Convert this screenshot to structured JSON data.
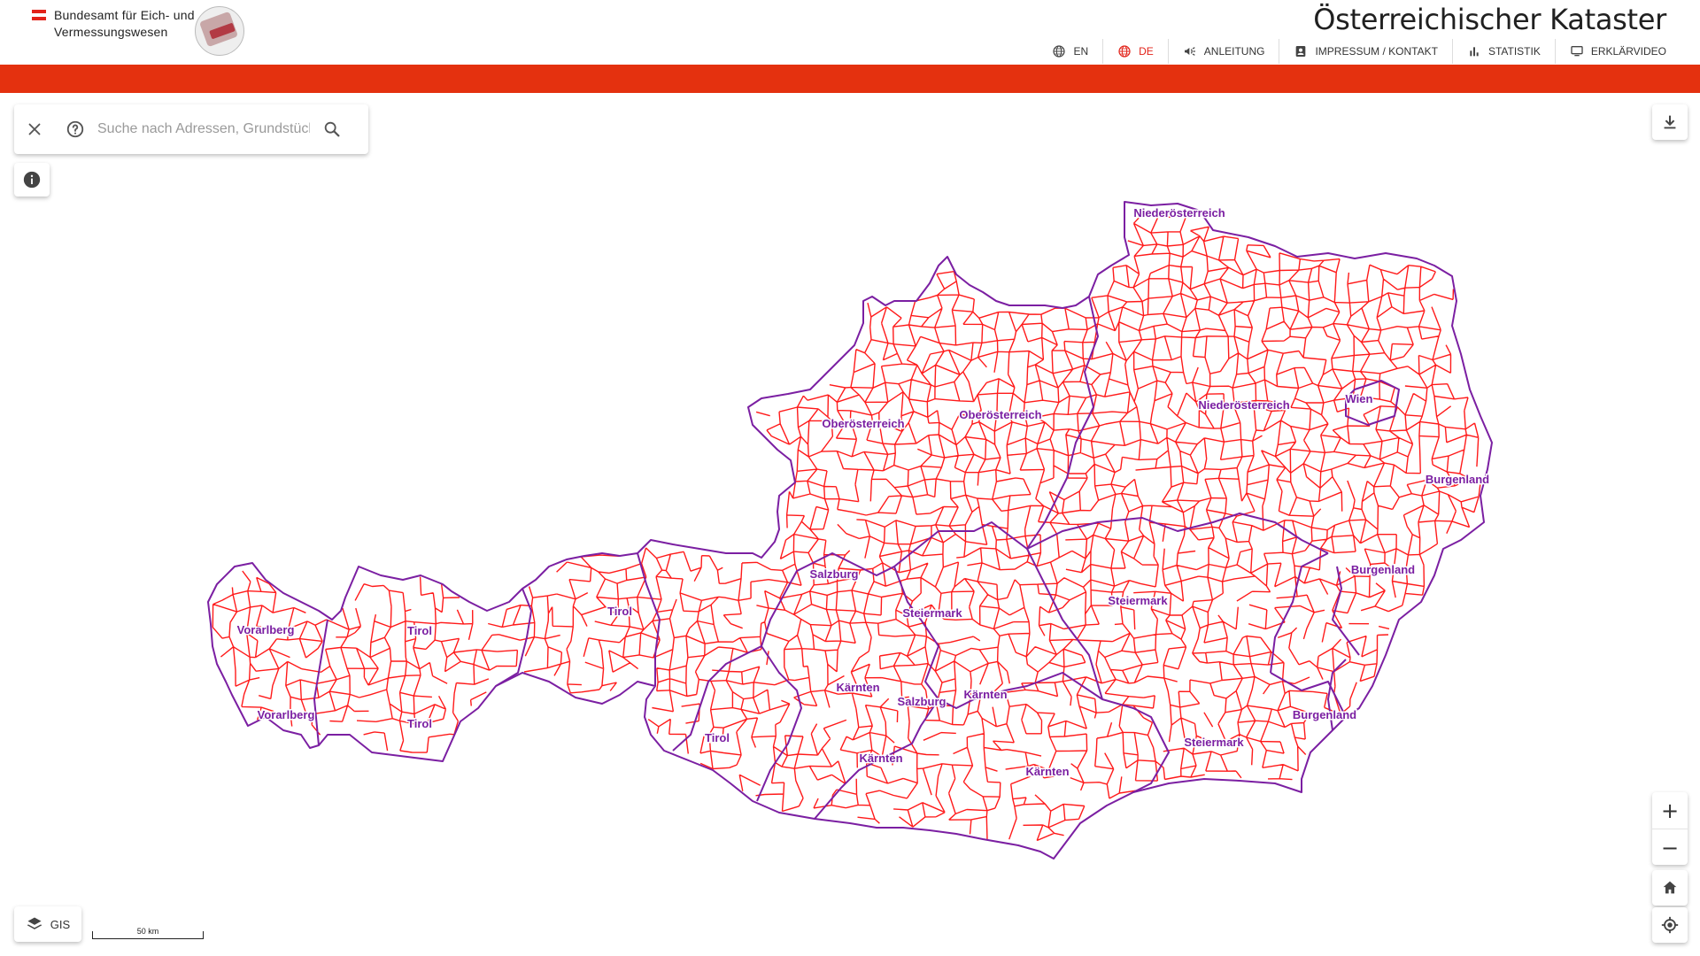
{
  "header": {
    "org_name": "Bundesamt für Eich- und Vermessungswesen",
    "app_title": "Österreichischer Kataster",
    "nav": [
      {
        "icon": "globe-icon",
        "label": "EN",
        "active": false
      },
      {
        "icon": "globe-icon",
        "label": "DE",
        "active": true
      },
      {
        "icon": "megaphone-icon",
        "label": "ANLEITUNG",
        "active": false
      },
      {
        "icon": "contact-card-icon",
        "label": "IMPRESSUM / KONTAKT",
        "active": false
      },
      {
        "icon": "bar-chart-icon",
        "label": "STATISTIK",
        "active": false
      },
      {
        "icon": "monitor-icon",
        "label": "ERKLÄRVIDEO",
        "active": false
      }
    ]
  },
  "colors": {
    "accent": "#e4310f",
    "parcel_border": "#ff1a1a",
    "state_border": "#7b1fa2",
    "state_label": "#7b1fa2"
  },
  "search": {
    "placeholder": "Suche nach Adressen, Grundstücken"
  },
  "controls": {
    "zoom_in": "+",
    "zoom_out": "−",
    "layer_label": "GIS"
  },
  "scale": {
    "label": "50 km"
  },
  "map": {
    "region_labels": [
      "Niederösterreich",
      "Oberösterreich",
      "Oberösterreich",
      "Niederösterreich",
      "Wien",
      "Burgenland",
      "Salzburg",
      "Burgenland",
      "Steiermark",
      "Steiermark",
      "Vorarlberg",
      "Tirol",
      "Tirol",
      "Vorarlberg",
      "Tirol",
      "Tirol",
      "Kärnten",
      "Salzburg",
      "Kärnten",
      "Burgenland",
      "Kärnten",
      "Steiermark",
      "Kärnten"
    ]
  }
}
